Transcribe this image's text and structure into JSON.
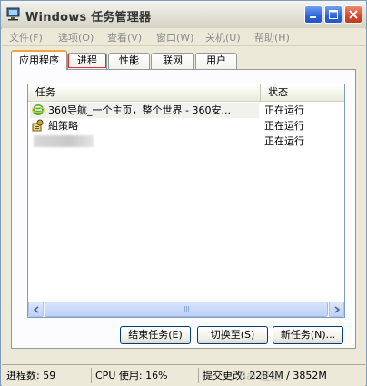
{
  "window": {
    "title": "Windows 任务管理器"
  },
  "menu": [
    "文件(F)",
    "选项(O)",
    "查看(V)",
    "窗口(W)",
    "关机(U)",
    "帮助(H)"
  ],
  "tabs": [
    {
      "label": "应用程序",
      "active": true
    },
    {
      "label": "进程",
      "active": false
    },
    {
      "label": "性能",
      "active": false
    },
    {
      "label": "联网",
      "active": false
    },
    {
      "label": "用户",
      "active": false
    }
  ],
  "list": {
    "columns": {
      "task": "任务",
      "status": "状态"
    },
    "rows": [
      {
        "task": "360导航_一个主页，整个世界 - 360安...",
        "status": "正在运行",
        "icon": "ie-360-icon"
      },
      {
        "task": "組策略",
        "status": "正在运行",
        "icon": "group-policy-icon"
      },
      {
        "task": "",
        "status": "正在运行",
        "icon": "blurred"
      }
    ]
  },
  "buttons": {
    "end_task": "结束任务(E)",
    "switch_to": "切换至(S)",
    "new_task": "新任务(N)..."
  },
  "status": {
    "processes": "进程数: 59",
    "cpu": "CPU 使用: 16%",
    "commit": "提交更改: 2284M / 3852M"
  },
  "watermark": "Bai 经验",
  "colors": {
    "title_close": "#d6472a",
    "title_buttons": "#2d63d8",
    "active_tab_border": "#f2a33a",
    "highlight_outline": "#e03030"
  }
}
